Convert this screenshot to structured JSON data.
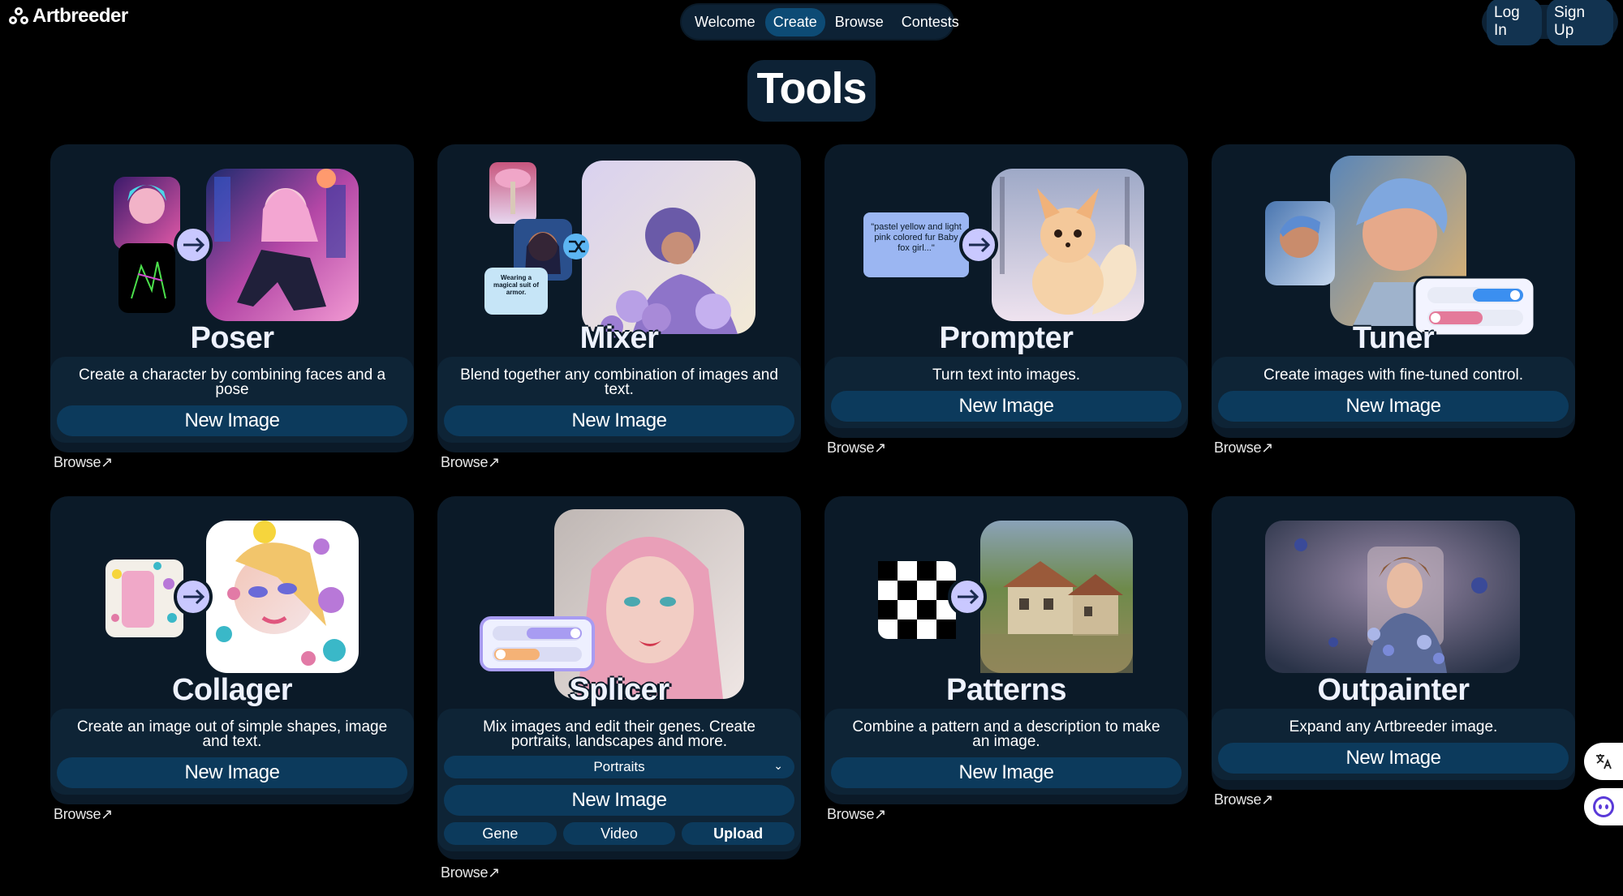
{
  "brand": {
    "name": "Artbreeder"
  },
  "nav": {
    "items": [
      "Welcome",
      "Create",
      "Browse",
      "Contests"
    ],
    "active": "Create"
  },
  "auth": {
    "login": "Log In",
    "signup": "Sign Up"
  },
  "page": {
    "title": "Tools"
  },
  "tools": [
    {
      "name": "Poser",
      "description": "Create a character by combining faces and a pose",
      "button": "New Image",
      "browse": "Browse↗"
    },
    {
      "name": "Mixer",
      "description": "Blend together any combination of images and text.",
      "button": "New Image",
      "browse": "Browse↗",
      "art_text": "Wearing a magical suit of armor."
    },
    {
      "name": "Prompter",
      "description": "Turn text into images.",
      "button": "New Image",
      "browse": "Browse↗",
      "art_text": "\"pastel yellow and light pink colored fur Baby fox girl...\""
    },
    {
      "name": "Tuner",
      "description": "Create images with fine-tuned control.",
      "button": "New Image",
      "browse": "Browse↗"
    },
    {
      "name": "Collager",
      "description": "Create an image out of simple shapes, image and text.",
      "button": "New Image",
      "browse": "Browse↗"
    },
    {
      "name": "Splicer",
      "description": "Mix images and edit their genes. Create portraits, landscapes and more.",
      "select_value": "Portraits",
      "button": "New Image",
      "actions": [
        "Gene",
        "Video",
        "Upload"
      ],
      "browse": "Browse↗"
    },
    {
      "name": "Patterns",
      "description": "Combine a pattern and a description to make an image.",
      "button": "New Image",
      "browse": "Browse↗"
    },
    {
      "name": "Outpainter",
      "description": "Expand any Artbreeder image.",
      "button": "New Image",
      "browse": "Browse↗"
    }
  ],
  "colors": {
    "background": "#000000",
    "card": "#0b1a28",
    "card_body": "#0e2436",
    "button": "#0c3a5c",
    "nav_active": "#0d4b75"
  },
  "icons": {
    "logo": "artbreeder-logo-icon",
    "arrow": "arrow-right-icon",
    "shuffle": "shuffle-icon",
    "translate": "translate-icon",
    "chat": "chat-bot-icon",
    "chevron": "chevron-down-icon"
  }
}
